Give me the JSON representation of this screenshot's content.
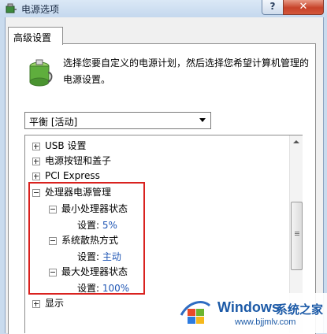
{
  "window": {
    "title": "电源选项",
    "help_label": "?",
    "close_label": "✕"
  },
  "tab": {
    "label": "高级设置"
  },
  "description": "选择您要自定义的电源计划，然后选择您希望计算机管理的电源设置。",
  "plan_select": {
    "value": "平衡 [活动]"
  },
  "tree": {
    "usb": "USB 设置",
    "buttons_lid": "电源按钮和盖子",
    "pci": "PCI Express",
    "cpu": "处理器电源管理",
    "min_state": "最小处理器状态",
    "min_setting_label": "设置:",
    "min_setting_value": "5%",
    "cooling": "系统散热方式",
    "cooling_setting_label": "设置:",
    "cooling_setting_value": "主动",
    "max_state": "最大处理器状态",
    "max_setting_label": "设置:",
    "max_setting_value": "100%",
    "display": "显示"
  },
  "watermark": {
    "brand": "Windows",
    "cn": "系统之家",
    "url": "www.bjjmlv.com"
  },
  "colors": {
    "highlight": "#d9221f",
    "value": "#1e55b4"
  }
}
